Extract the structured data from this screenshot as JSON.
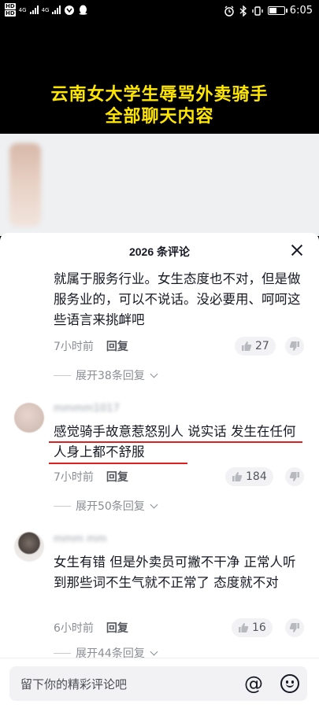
{
  "status_bar": {
    "hd1": "HD",
    "hd2": "HD",
    "net1": "4G",
    "net2": "4G",
    "time": "6:05"
  },
  "video": {
    "title_line1": "云南女大学生辱骂外卖骑手",
    "title_line2": "全部聊天内容"
  },
  "comments_panel": {
    "title": "2026 条评论",
    "comments": [
      {
        "text": "就属于服务行业。女生态度也不对，但是做服务业的，可以不说话。没必要用、呵呵这些语言来挑衅吧",
        "time": "7小时前",
        "reply_label": "回复",
        "likes": "27",
        "expand_label": "展开38条回复"
      },
      {
        "username": "mmmm1017",
        "text": "感觉骑手故意惹怒别人 说实话 发生在任何人身上都不舒服",
        "time": "7小时前",
        "reply_label": "回复",
        "likes": "184",
        "expand_label": "展开50条回复"
      },
      {
        "username": "mmm mm",
        "text": "女生有错 但是外卖员可撇不干净 正常人听到那些词不生气就不正常了 态度就不对",
        "time": "6小时前",
        "reply_label": "回复",
        "likes": "16",
        "expand_label": "展开44条回复"
      }
    ]
  },
  "input_bar": {
    "placeholder": "留下你的精彩评论吧",
    "at_symbol": "@"
  },
  "colors": {
    "title_yellow": "#ffe600",
    "underline_red": "#e02020",
    "text_primary": "#161823",
    "text_secondary": "#8a8d93"
  }
}
